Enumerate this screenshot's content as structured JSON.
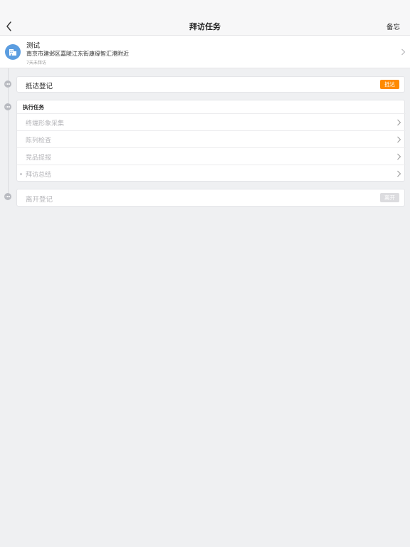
{
  "nav": {
    "back_icon": "chevron-left-icon",
    "title": "拜访任务",
    "right_action": "备忘"
  },
  "store": {
    "avatar_icon": "building-icon",
    "name": "测试",
    "address": "南京市建邺区嘉陵江东街康缘智汇港附近",
    "status": "7天未拜访"
  },
  "arrival": {
    "label": "抵达登记",
    "button": "抵达",
    "button_color": "#ff8a00"
  },
  "execution": {
    "header": "执行任务",
    "items": [
      {
        "label": "终端形象采集"
      },
      {
        "label": "陈列检查"
      },
      {
        "label": "竞品提报"
      },
      {
        "label": "拜访总结"
      }
    ]
  },
  "departure": {
    "label": "离开登记",
    "button": "离开",
    "button_color": "#dcdcdf"
  }
}
